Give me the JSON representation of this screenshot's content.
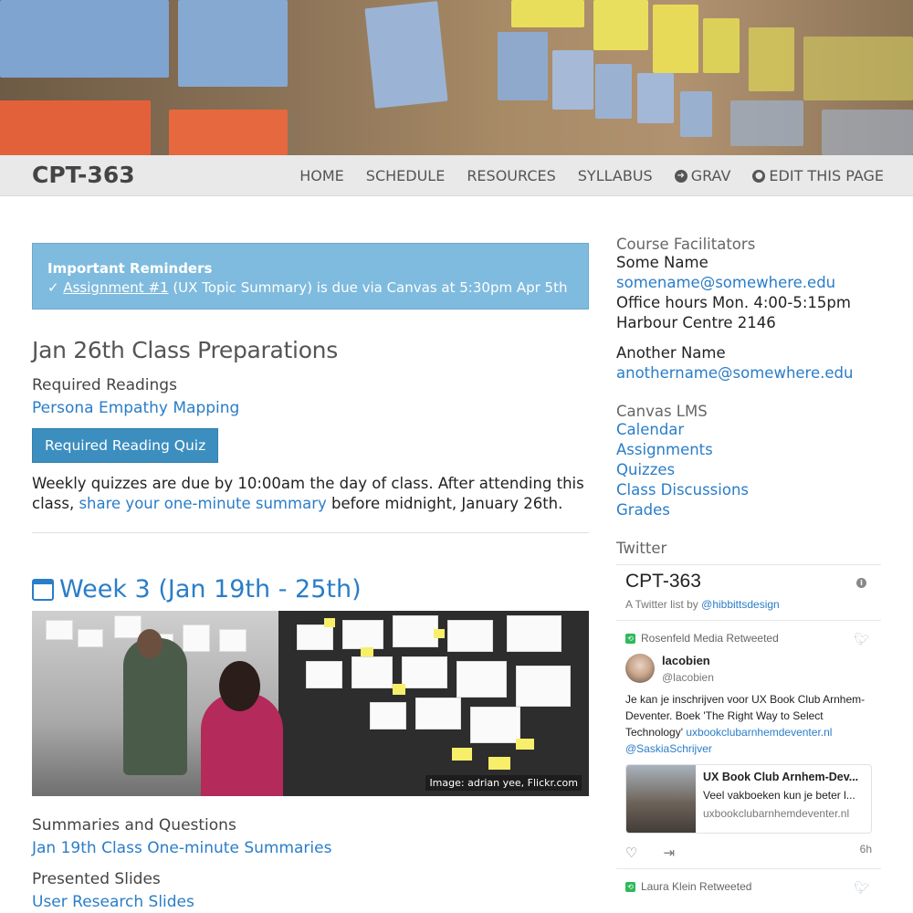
{
  "header": {
    "brand": "CPT-363",
    "nav": [
      {
        "label": "HOME"
      },
      {
        "label": "SCHEDULE"
      },
      {
        "label": "RESOURCES"
      },
      {
        "label": "SYLLABUS"
      },
      {
        "label": "GRAV",
        "icon": "arrow-circle-right-icon"
      },
      {
        "label": "EDIT THIS PAGE",
        "icon": "github-icon"
      }
    ]
  },
  "reminders": {
    "title": "Important Reminders",
    "check": "✓",
    "link": "Assignment #1",
    "text": " (UX Topic Summary) is due via Canvas at 5:30pm Apr 5th"
  },
  "prep": {
    "heading": "Jan 26th Class Preparations",
    "readings_label": "Required Readings",
    "reading_link": "Persona Empathy Mapping",
    "quiz_button": "Required Reading Quiz",
    "para_before": "Weekly quizzes are due by 10:00am the day of class. After attending this class, ",
    "para_link": "share your one-minute summary",
    "para_after": " before midnight, January 26th."
  },
  "week": {
    "heading": "Week 3 (Jan 19th - 25th)",
    "image_caption": "Image: adrian yee, Flickr.com",
    "summaries_label": "Summaries and Questions",
    "summaries_link": "Jan 19th Class One-minute Summaries",
    "slides_label": "Presented Slides",
    "slides_link": "User Research Slides"
  },
  "sidebar": {
    "facilitators_header": "Course Facilitators",
    "person1": {
      "name": "Some Name",
      "email": "somename@somewhere.edu",
      "hours": "Office hours Mon. 4:00-5:15pm",
      "room": "Harbour Centre 2146"
    },
    "person2": {
      "name": "Another Name",
      "email": "anothername@somewhere.edu"
    },
    "canvas_header": "Canvas LMS",
    "canvas_links": [
      "Calendar",
      "Assignments",
      "Quizzes",
      "Class Discussions",
      "Grades"
    ],
    "twitter_header": "Twitter"
  },
  "twitter": {
    "list_title": "CPT-363",
    "by_prefix": "A Twitter list by ",
    "by_handle": "@hibbittsdesign",
    "tweet1": {
      "retweeted_by": "Rosenfeld Media Retweeted",
      "name": "lacobien",
      "handle": "@lacobien",
      "text": "Je kan je inschrijven voor UX Book Club Arnhem-Deventer. Boek 'The Right Way to Select Technology' ",
      "link": "uxbookclubarnhemdeventer.nl",
      "mention": "@SaskiaSchrijver",
      "card_title": "UX Book Club Arnhem-Dev...",
      "card_desc": "Veel vakboeken kun je beter l...",
      "card_url": "uxbookclubarnhemdeventer.nl",
      "time": "6h"
    },
    "tweet2": {
      "retweeted_by": "Laura Klein Retweeted"
    }
  },
  "colors": {
    "link": "#2a7dc8",
    "alert_bg": "#7fbbde",
    "button_bg": "#3c8ebf",
    "navbar_bg": "#e9e9e9"
  }
}
